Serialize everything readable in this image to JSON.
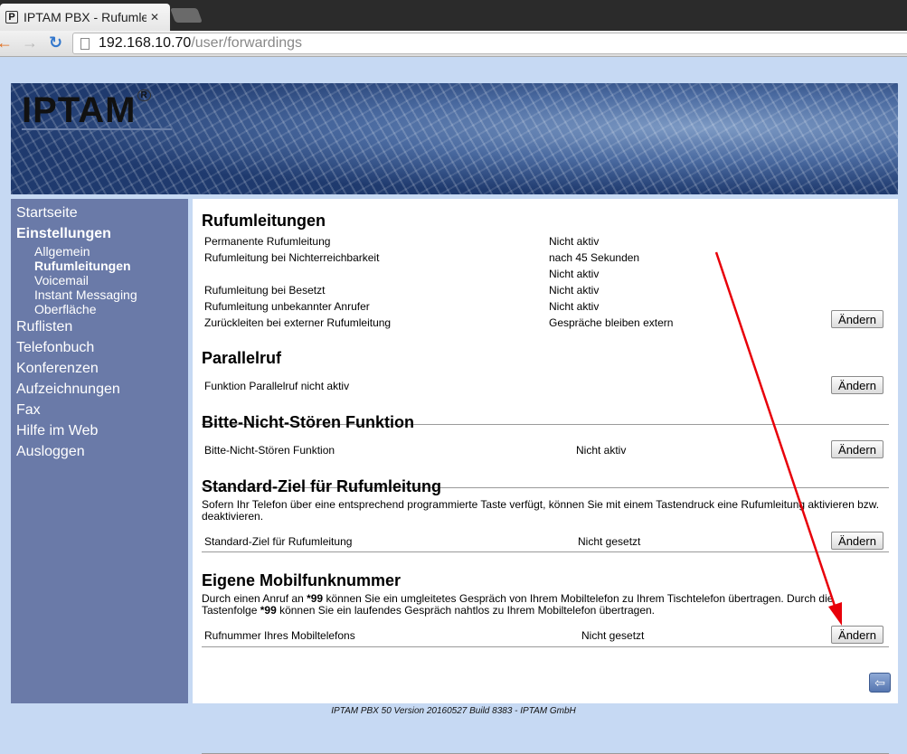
{
  "browser": {
    "tab_title": "IPTAM PBX - Rufumleitungen",
    "tab_favicon": "P",
    "tab_close": "✕",
    "url_host": "192.168.10.70",
    "url_path": "/user/forwardings",
    "icons": {
      "back": "arrow-left-icon",
      "forward": "arrow-right-icon",
      "reload": "reload-icon",
      "page": "page-icon"
    }
  },
  "banner": {
    "logo_text": "IPTAM",
    "logo_mark": "R"
  },
  "sidebar": {
    "items": [
      {
        "label": "Startseite"
      },
      {
        "label": "Einstellungen",
        "active": true
      },
      {
        "label": "Ruflisten"
      },
      {
        "label": "Telefonbuch"
      },
      {
        "label": "Konferenzen"
      },
      {
        "label": "Aufzeichnungen"
      },
      {
        "label": "Fax"
      },
      {
        "label": "Hilfe im Web"
      },
      {
        "label": "Ausloggen"
      }
    ],
    "subitems": [
      {
        "label": "Allgemein"
      },
      {
        "label": "Rufumleitungen",
        "active": true
      },
      {
        "label": "Voicemail"
      },
      {
        "label": "Instant Messaging"
      },
      {
        "label": "Oberfläche"
      }
    ]
  },
  "sections": {
    "rufumleitungen": {
      "title": "Rufumleitungen",
      "rows": [
        {
          "label": "Permanente Rufumleitung",
          "value": "Nicht aktiv"
        },
        {
          "label": "Rufumleitung bei Nichterreichbarkeit",
          "value": "nach 45 Sekunden"
        },
        {
          "label": "",
          "value": "Nicht aktiv"
        },
        {
          "label": "Rufumleitung bei Besetzt",
          "value": "Nicht aktiv"
        },
        {
          "label": "Rufumleitung unbekannter Anrufer",
          "value": "Nicht aktiv"
        },
        {
          "label": "Zurückleiten bei externer Rufumleitung",
          "value": "Gespräche bleiben extern"
        }
      ],
      "button": "Ändern"
    },
    "parallelruf": {
      "title": "Parallelruf",
      "label": "Funktion Parallelruf nicht aktiv",
      "button": "Ändern"
    },
    "bns": {
      "title": "Bitte-Nicht-Stören Funktion",
      "label": "Bitte-Nicht-Stören Funktion",
      "value": "Nicht aktiv",
      "button": "Ändern"
    },
    "standardziel": {
      "title": "Standard-Ziel für Rufumleitung",
      "description": "Sofern Ihr Telefon über eine entsprechend programmierte Taste verfügt, können Sie mit einem Tastendruck eine Rufumleitung aktivieren bzw. deaktivieren.",
      "label": "Standard-Ziel für Rufumleitung",
      "value": "Nicht gesetzt",
      "button": "Ändern"
    },
    "mobil": {
      "title": "Eigene Mobilfunknummer",
      "desc_part1": "Durch einen Anruf an ",
      "desc_code1": "*99",
      "desc_part2": " können Sie ein umgleitetes Gespräch von Ihrem Mobiltelefon zu Ihrem Tischtelefon übertragen. Durch die Tastenfolge ",
      "desc_code2": "*99",
      "desc_part3": " können Sie ein laufendes Gespräch nahtlos zu Ihrem Mobiltelefon übertragen.",
      "label": "Rufnummer Ihres Mobiltelefons",
      "value": "Nicht gesetzt",
      "button": "Ändern"
    }
  },
  "back_button": {
    "icon": "back-arrow-icon",
    "glyph": "⇦"
  },
  "footer": "IPTAM PBX 50 Version 20160527 Build 8383 - IPTAM GmbH",
  "colors": {
    "sidebar": "#6a7aa8",
    "page_bg": "#c6d9f3",
    "annotation_arrow": "#e8000a"
  }
}
